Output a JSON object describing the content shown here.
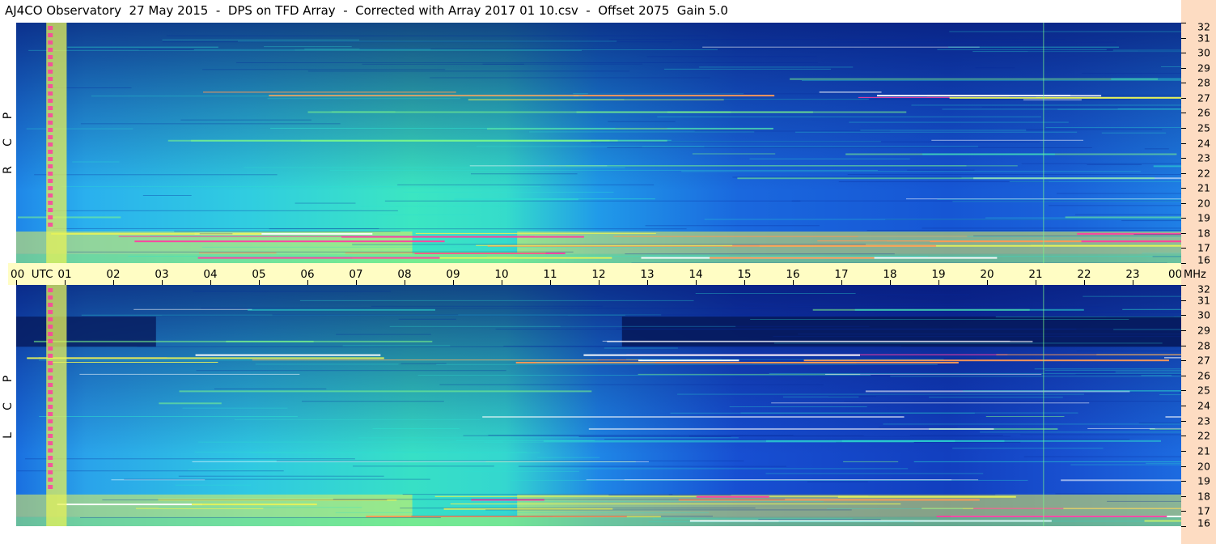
{
  "title": "AJ4CO Observatory  27 May 2015  -  DPS on TFD Array  -  Corrected with Array 2017 01 10.csv  -  Offset 2075  Gain 5.0",
  "chart_data": {
    "type": "heatmap",
    "description_type": "spectrogram",
    "x_unit": "UTC",
    "x_ticks": [
      "00",
      "01",
      "02",
      "03",
      "04",
      "05",
      "06",
      "07",
      "08",
      "09",
      "10",
      "11",
      "12",
      "13",
      "14",
      "15",
      "16",
      "17",
      "18",
      "19",
      "20",
      "21",
      "22",
      "23",
      "00"
    ],
    "x_label_first": "00  UTC",
    "y_unit": "MHz",
    "y_ticks": [
      16,
      17,
      18,
      19,
      20,
      21,
      22,
      23,
      24,
      25,
      26,
      27,
      28,
      29,
      30,
      31,
      32
    ],
    "ylim": [
      16,
      32
    ],
    "xlim_hours": [
      0,
      24
    ],
    "panels": [
      {
        "name": "RCP",
        "letters": [
          "R",
          "C",
          "P"
        ]
      },
      {
        "name": "LCP",
        "letters": [
          "L",
          "C",
          "P"
        ]
      }
    ],
    "colormap": [
      "#000b3a",
      "#0a2a9a",
      "#1750d8",
      "#1e7de8",
      "#22b3ee",
      "#2ee0d0",
      "#7dfa8a",
      "#e6f25a",
      "#ff9a55",
      "#ff3ea0",
      "#ffffff"
    ]
  }
}
